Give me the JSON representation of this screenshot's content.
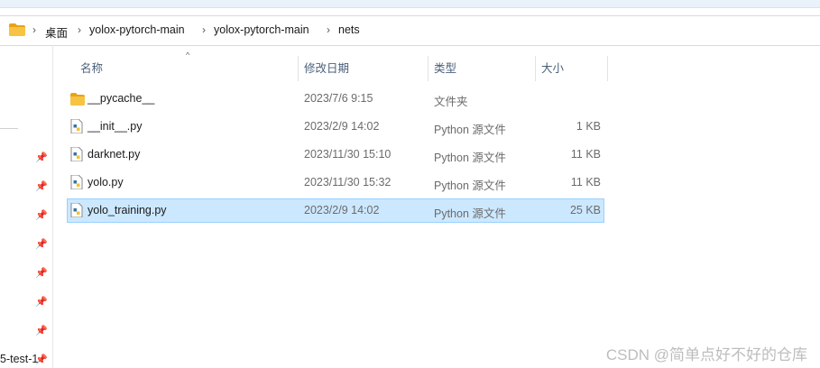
{
  "address": {
    "breadcrumbs": [
      "桌面",
      "yolox-pytorch-main",
      "yolox-pytorch-main",
      "nets"
    ],
    "separator": "›"
  },
  "columns": {
    "name": "名称",
    "modified": "修改日期",
    "type": "类型",
    "size": "大小"
  },
  "files": [
    {
      "name": "__pycache__",
      "modified": "2023/7/6 9:15",
      "type": "文件夹",
      "size": "",
      "icon": "folder-icon"
    },
    {
      "name": "__init__.py",
      "modified": "2023/2/9 14:02",
      "type": "Python 源文件",
      "size": "1 KB",
      "icon": "python-file-icon"
    },
    {
      "name": "darknet.py",
      "modified": "2023/11/30 15:10",
      "type": "Python 源文件",
      "size": "11 KB",
      "icon": "python-file-icon"
    },
    {
      "name": "yolo.py",
      "modified": "2023/11/30 15:32",
      "type": "Python 源文件",
      "size": "11 KB",
      "icon": "python-file-icon"
    },
    {
      "name": "yolo_training.py",
      "modified": "2023/2/9 14:02",
      "type": "Python 源文件",
      "size": "25 KB",
      "icon": "python-file-icon",
      "selected": true
    }
  ],
  "sidebar": {
    "partial_label": "5-test-1"
  },
  "watermark": "CSDN @简单点好不好的仓库",
  "colors": {
    "selection_bg": "#cce8ff",
    "selection_border": "#99d1ff",
    "folder": "#f6c343"
  }
}
